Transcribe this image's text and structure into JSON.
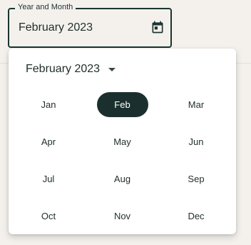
{
  "field": {
    "label": "Year and Month",
    "value": "February 2023",
    "icon": "calendar-icon"
  },
  "picker": {
    "header_label": "February 2023",
    "caret_icon": "dropdown-arrow-icon",
    "selected_month": "Feb",
    "months": [
      "Jan",
      "Feb",
      "Mar",
      "Apr",
      "May",
      "Jun",
      "Jul",
      "Aug",
      "Sep",
      "Oct",
      "Nov",
      "Dec"
    ]
  },
  "colors": {
    "accent": "#1b302e",
    "surface": "#ffffff",
    "page_background": "#f4f1ec",
    "text": "#1f2e2c"
  }
}
